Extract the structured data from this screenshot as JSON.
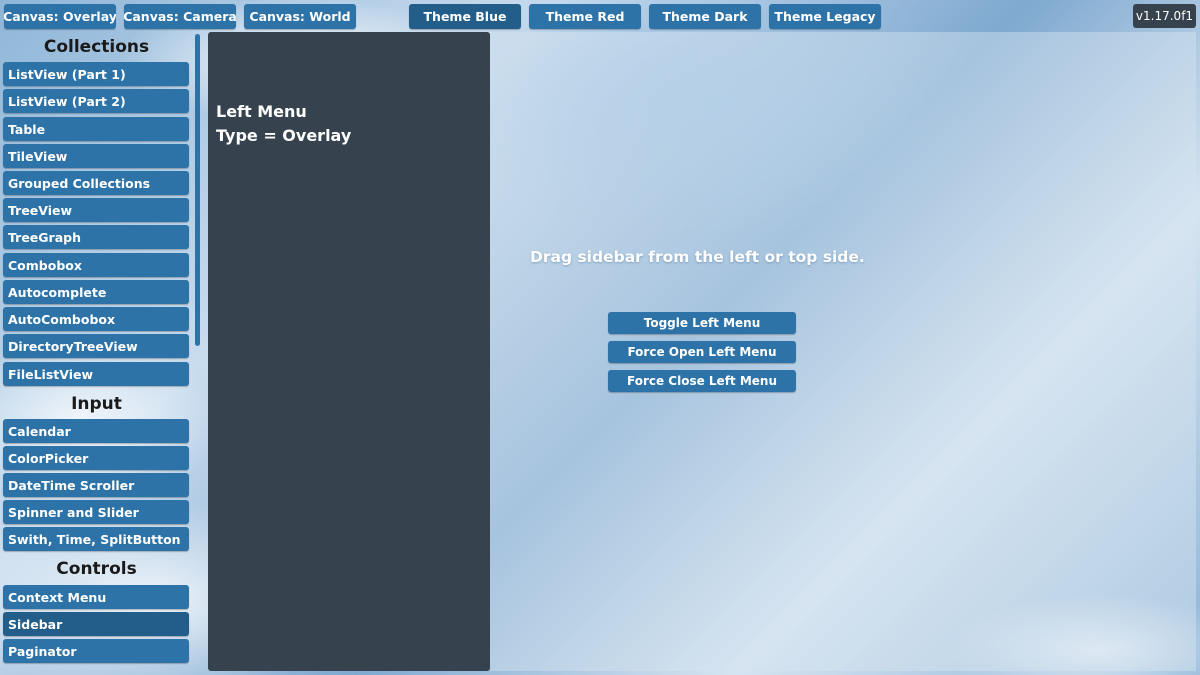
{
  "canvas_buttons": [
    "Canvas: Overlay",
    "Canvas: Camera",
    "Canvas: World"
  ],
  "theme_buttons": [
    "Theme Blue",
    "Theme Red",
    "Theme Dark",
    "Theme Legacy"
  ],
  "version": "v1.17.0f1",
  "sidebar": {
    "sections": [
      {
        "title": "Collections",
        "items": [
          "ListView (Part 1)",
          "ListView (Part 2)",
          "Table",
          "TileView",
          "Grouped Collections",
          "TreeView",
          "TreeGraph",
          "Combobox",
          "Autocomplete",
          "AutoCombobox",
          "DirectoryTreeView",
          "FileListView"
        ]
      },
      {
        "title": "Input",
        "items": [
          "Calendar",
          "ColorPicker",
          "DateTime Scroller",
          "Spinner and Slider",
          "Swith, Time, SplitButton"
        ]
      },
      {
        "title": "Controls",
        "items": [
          "Context Menu",
          "Sidebar",
          "Paginator"
        ]
      }
    ]
  },
  "left_menu": {
    "title_line1": "Left Menu",
    "title_line2": "Type = Overlay"
  },
  "main": {
    "hint": "Drag sidebar from the left or top side.",
    "actions": [
      "Toggle Left Menu",
      "Force Open Left Menu",
      "Force Close Left Menu"
    ]
  },
  "colors": {
    "button": "#2d73a8",
    "button_active": "#235e8a",
    "panel_dark": "#36434f"
  }
}
